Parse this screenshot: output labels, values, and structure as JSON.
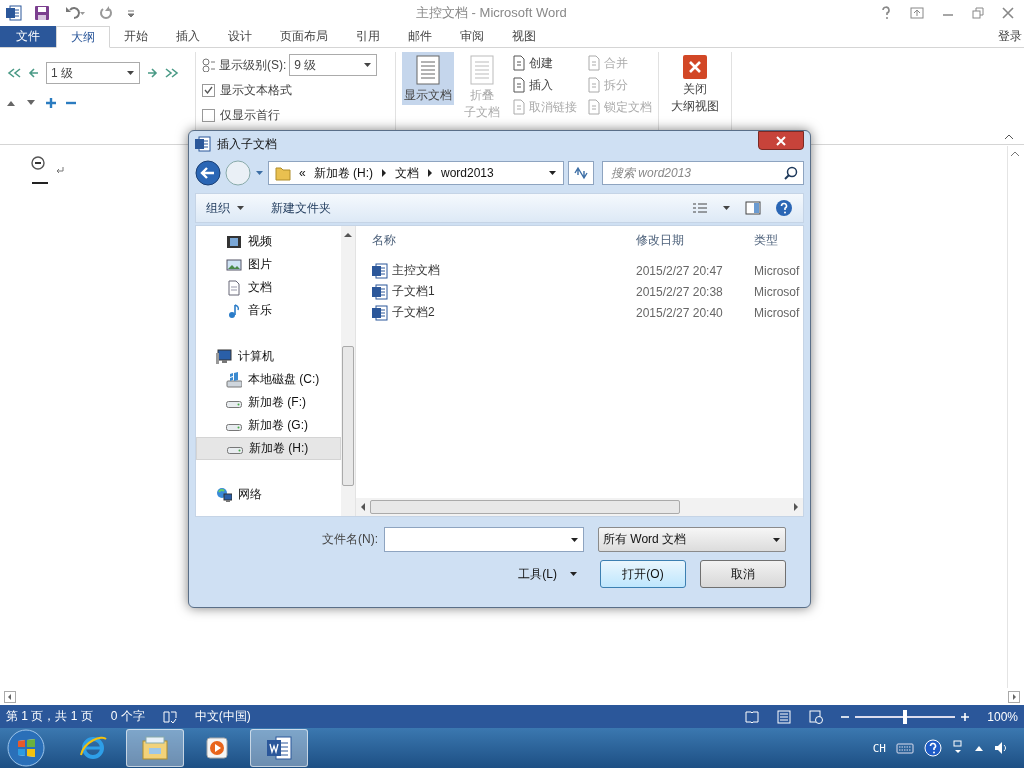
{
  "window": {
    "title": "主控文档 - Microsoft Word"
  },
  "tabs": [
    {
      "label": "文件",
      "kind": "file",
      "selected": false
    },
    {
      "label": "大纲",
      "kind": "tab",
      "selected": true
    },
    {
      "label": "开始",
      "kind": "tab",
      "selected": false
    },
    {
      "label": "插入",
      "kind": "tab",
      "selected": false
    },
    {
      "label": "设计",
      "kind": "tab",
      "selected": false
    },
    {
      "label": "页面布局",
      "kind": "tab",
      "selected": false
    },
    {
      "label": "引用",
      "kind": "tab",
      "selected": false
    },
    {
      "label": "邮件",
      "kind": "tab",
      "selected": false
    },
    {
      "label": "审阅",
      "kind": "tab",
      "selected": false
    },
    {
      "label": "视图",
      "kind": "tab",
      "selected": false
    }
  ],
  "sign_in": "登录",
  "ribbon": {
    "outline_level": "1 级",
    "display": {
      "level_label": "显示级别(S):",
      "level_value": "9 级",
      "options": [
        {
          "label": "显示文本格式",
          "checked": true
        },
        {
          "label": "仅显示首行",
          "checked": false
        }
      ]
    },
    "master_document": {
      "large": [
        {
          "lines": [
            "显示文档"
          ],
          "selected": true,
          "disabled": false
        },
        {
          "lines": [
            "折叠",
            "子文档"
          ],
          "selected": false,
          "disabled": true
        }
      ],
      "small": [
        {
          "label": "创建",
          "disabled": false
        },
        {
          "label": "插入",
          "disabled": false
        },
        {
          "label": "取消链接",
          "disabled": true
        },
        {
          "label": "合并",
          "disabled": true
        },
        {
          "label": "拆分",
          "disabled": true
        },
        {
          "label": "锁定文档",
          "disabled": true
        }
      ]
    },
    "close": {
      "lines": [
        "关闭",
        "大纲视图"
      ]
    }
  },
  "dialog": {
    "title": "插入子文档",
    "path_overflow": "«",
    "path": [
      "新加卷 (H:)",
      "文档",
      "word2013"
    ],
    "search_placeholder": "搜索 word2013",
    "toolbar": [
      {
        "label": "组织",
        "kind": "menu"
      },
      {
        "label": "新建文件夹",
        "kind": "button"
      }
    ],
    "nav": [
      {
        "children": [
          {
            "label": "视频",
            "kind": "video",
            "selected": false
          },
          {
            "label": "图片",
            "kind": "picture",
            "selected": false
          },
          {
            "label": "文档",
            "kind": "document",
            "selected": false
          },
          {
            "label": "音乐",
            "kind": "music",
            "selected": false
          }
        ]
      },
      {
        "label": "计算机",
        "kind": "computer",
        "children": [
          {
            "label": "本地磁盘 (C:)",
            "kind": "system",
            "selected": false
          },
          {
            "label": "新加卷 (F:)",
            "kind": "drive",
            "selected": false
          },
          {
            "label": "新加卷 (G:)",
            "kind": "drive",
            "selected": false
          },
          {
            "label": "新加卷 (H:)",
            "kind": "drive",
            "selected": true
          }
        ]
      },
      {
        "label": "网络",
        "kind": "network"
      }
    ],
    "columns": [
      "名称",
      "修改日期",
      "类型"
    ],
    "rows": [
      {
        "name": "主控文档",
        "date": "2015/2/27 20:47",
        "type": "Microsof"
      },
      {
        "name": "子文档1",
        "date": "2015/2/27 20:38",
        "type": "Microsof"
      },
      {
        "name": "子文档2",
        "date": "2015/2/27 20:40",
        "type": "Microsof"
      }
    ],
    "file_name_label": "文件名(N):",
    "filter": "所有 Word 文档",
    "tools": "工具(L)",
    "buttons": [
      {
        "label": "打开(O)",
        "default": true
      },
      {
        "label": "取消",
        "default": false
      }
    ]
  },
  "status_bar": {
    "items": [
      "第 1 页，共 1 页",
      "0 个字",
      "中文(中国)"
    ],
    "zoom": {
      "level": 0.5,
      "reading": "100%"
    }
  },
  "taskbar": {
    "apps": [
      {
        "kind": "ie",
        "active": false
      },
      {
        "kind": "explorer",
        "active": true
      },
      {
        "kind": "media",
        "active": false
      },
      {
        "kind": "word",
        "active": true
      }
    ],
    "ime": "CH"
  }
}
